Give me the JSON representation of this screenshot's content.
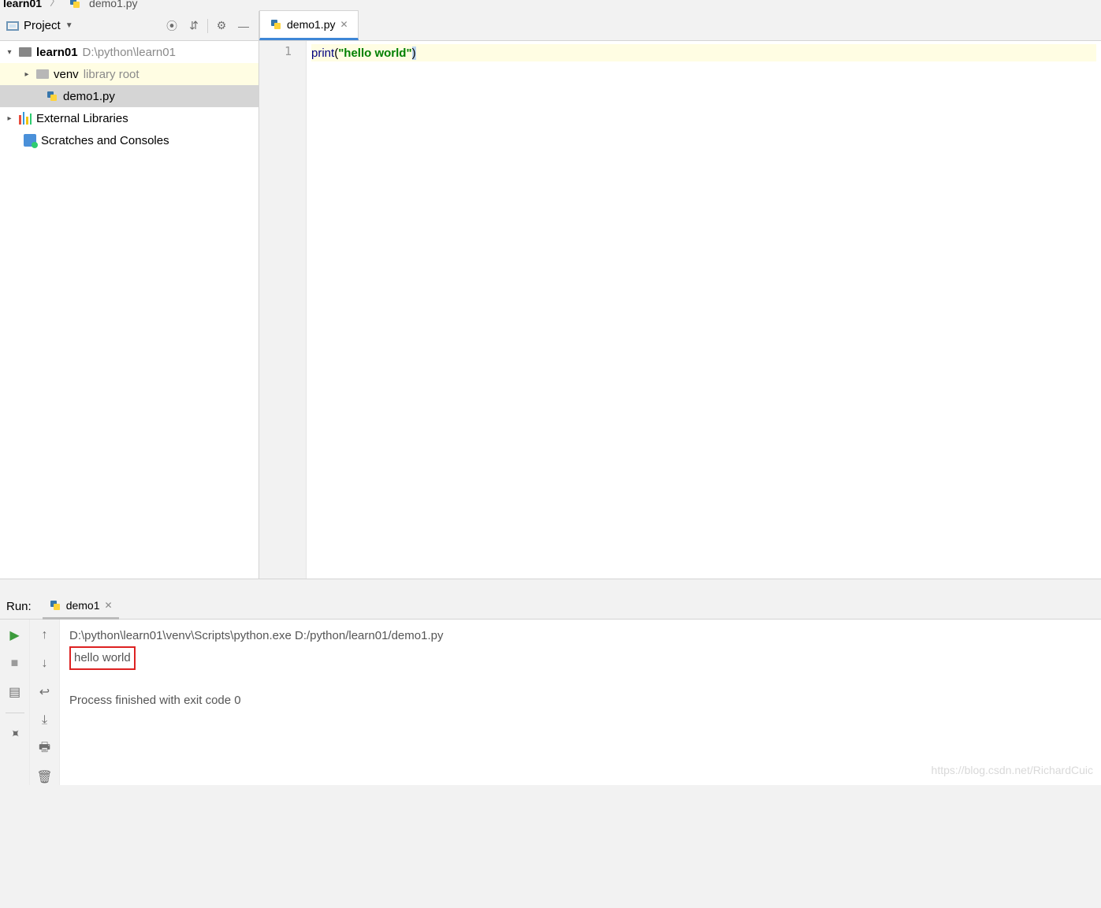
{
  "breadcrumb": {
    "item1": "learn01",
    "item2": "demo1.py"
  },
  "project_header": {
    "label": "Project"
  },
  "tree": {
    "root": {
      "name": "learn01",
      "path": "D:\\python\\learn01"
    },
    "venv": {
      "name": "venv",
      "hint": "library root"
    },
    "file": {
      "name": "demo1.py"
    },
    "ext": "External Libraries",
    "scratch": "Scratches and Consoles"
  },
  "tab": {
    "name": "demo1.py"
  },
  "code": {
    "line1_no": "1",
    "fn": "print",
    "lp": "(",
    "str": "\"hello world\"",
    "rp": ")"
  },
  "run": {
    "label": "Run:",
    "tabname": "demo1",
    "line1": "D:\\python\\learn01\\venv\\Scripts\\python.exe D:/python/learn01/demo1.py",
    "line2": "hello world",
    "line3": "Process finished with exit code 0"
  },
  "watermark": "https://blog.csdn.net/RichardCuic"
}
